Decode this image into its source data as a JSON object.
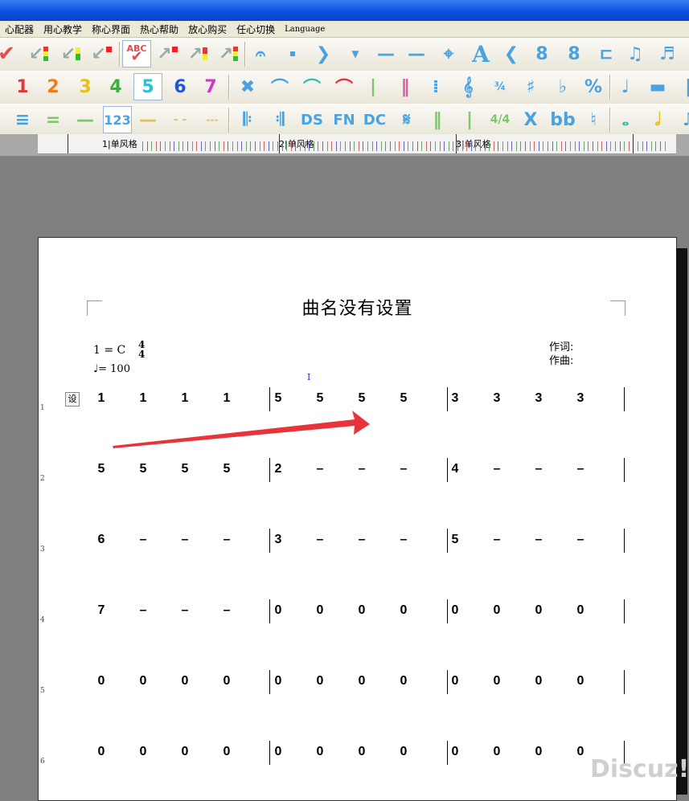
{
  "menu": [
    "心配器",
    "用心教学",
    "称心界面",
    "热心帮助",
    "放心购买",
    "任心切换",
    "Language"
  ],
  "toolbar_numbers": [
    "1",
    "2",
    "3",
    "4",
    "5",
    "6",
    "7"
  ],
  "toolbar_row2_symbols": [
    "✕",
    "⁀",
    "⁀",
    "⁀",
    "‖",
    "‖",
    "⁞",
    "𝄞",
    "¾",
    "♯",
    "♭",
    "𝄎",
    "♩",
    "–"
  ],
  "toolbar_row3_labels": [
    "123",
    "DS",
    "FN",
    "DC",
    "X",
    "bb"
  ],
  "ruler_labels": [
    "1|单风格",
    "2|单风格",
    "3|单风格"
  ],
  "score": {
    "title": "曲名没有设置",
    "key": "1 = C",
    "time_sig": {
      "num": "4",
      "den": "4"
    },
    "tempo": "= 100",
    "lyricist_label": "作词:",
    "composer_label": "作曲:",
    "set_button": "设",
    "cursor": "I",
    "rows": [
      {
        "num": "1",
        "bars": [
          [
            "1",
            "1",
            "1",
            "1"
          ],
          [
            "5",
            "5",
            "5",
            "5"
          ],
          [
            "3",
            "3",
            "3",
            "3"
          ]
        ]
      },
      {
        "num": "2",
        "bars": [
          [
            "5",
            "5",
            "5",
            "5"
          ],
          [
            "2",
            "–",
            "–",
            "–"
          ],
          [
            "4",
            "–",
            "–",
            "–"
          ]
        ]
      },
      {
        "num": "3",
        "bars": [
          [
            "6",
            "–",
            "–",
            "–"
          ],
          [
            "3",
            "–",
            "–",
            "–"
          ],
          [
            "5",
            "–",
            "–",
            "–"
          ]
        ]
      },
      {
        "num": "4",
        "bars": [
          [
            "7",
            "–",
            "–",
            "–"
          ],
          [
            "0",
            "0",
            "0",
            "0"
          ],
          [
            "0",
            "0",
            "0",
            "0"
          ]
        ]
      },
      {
        "num": "5",
        "bars": [
          [
            "0",
            "0",
            "0",
            "0"
          ],
          [
            "0",
            "0",
            "0",
            "0"
          ],
          [
            "0",
            "0",
            "0",
            "0"
          ]
        ]
      },
      {
        "num": "6",
        "bars": [
          [
            "0",
            "0",
            "0",
            "0"
          ],
          [
            "0",
            "0",
            "0",
            "0"
          ],
          [
            "0",
            "0",
            "0",
            "0"
          ]
        ]
      }
    ]
  },
  "annotation_color": "#e8333a",
  "watermark": "Discuz!"
}
